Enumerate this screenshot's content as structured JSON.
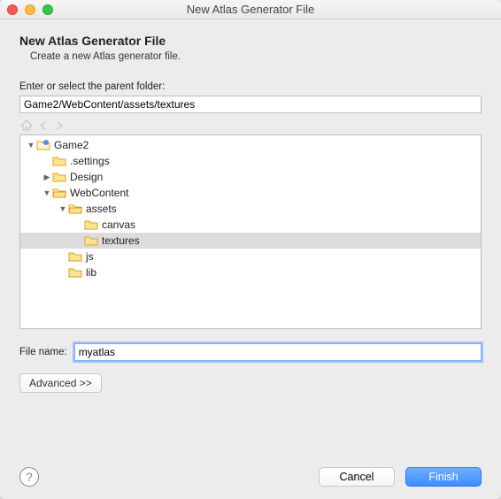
{
  "window": {
    "title": "New Atlas Generator File"
  },
  "header": {
    "heading": "New Atlas Generator File",
    "subtitle": "Create a new Atlas generator file."
  },
  "parentFolder": {
    "label": "Enter or select the parent folder:",
    "value": "Game2/WebContent/assets/textures"
  },
  "tree": {
    "items": [
      {
        "depth": 0,
        "arrow": "down",
        "open": true,
        "label": "Game2",
        "selected": false,
        "kind": "project"
      },
      {
        "depth": 1,
        "arrow": "none",
        "open": false,
        "label": ".settings",
        "selected": false,
        "kind": "folder"
      },
      {
        "depth": 1,
        "arrow": "right",
        "open": false,
        "label": "Design",
        "selected": false,
        "kind": "folder"
      },
      {
        "depth": 1,
        "arrow": "down",
        "open": true,
        "label": "WebContent",
        "selected": false,
        "kind": "folder"
      },
      {
        "depth": 2,
        "arrow": "down",
        "open": true,
        "label": "assets",
        "selected": false,
        "kind": "folder"
      },
      {
        "depth": 3,
        "arrow": "none",
        "open": false,
        "label": "canvas",
        "selected": false,
        "kind": "folder"
      },
      {
        "depth": 3,
        "arrow": "none",
        "open": false,
        "label": "textures",
        "selected": true,
        "kind": "folder"
      },
      {
        "depth": 2,
        "arrow": "none",
        "open": false,
        "label": "js",
        "selected": false,
        "kind": "folder"
      },
      {
        "depth": 2,
        "arrow": "none",
        "open": false,
        "label": "lib",
        "selected": false,
        "kind": "folder"
      }
    ]
  },
  "fileName": {
    "label": "File name:",
    "value": "myatlas"
  },
  "buttons": {
    "advanced": "Advanced >>",
    "cancel": "Cancel",
    "finish": "Finish"
  },
  "colors": {
    "primary": "#3e8dff",
    "focusRing": "#77aefc"
  }
}
